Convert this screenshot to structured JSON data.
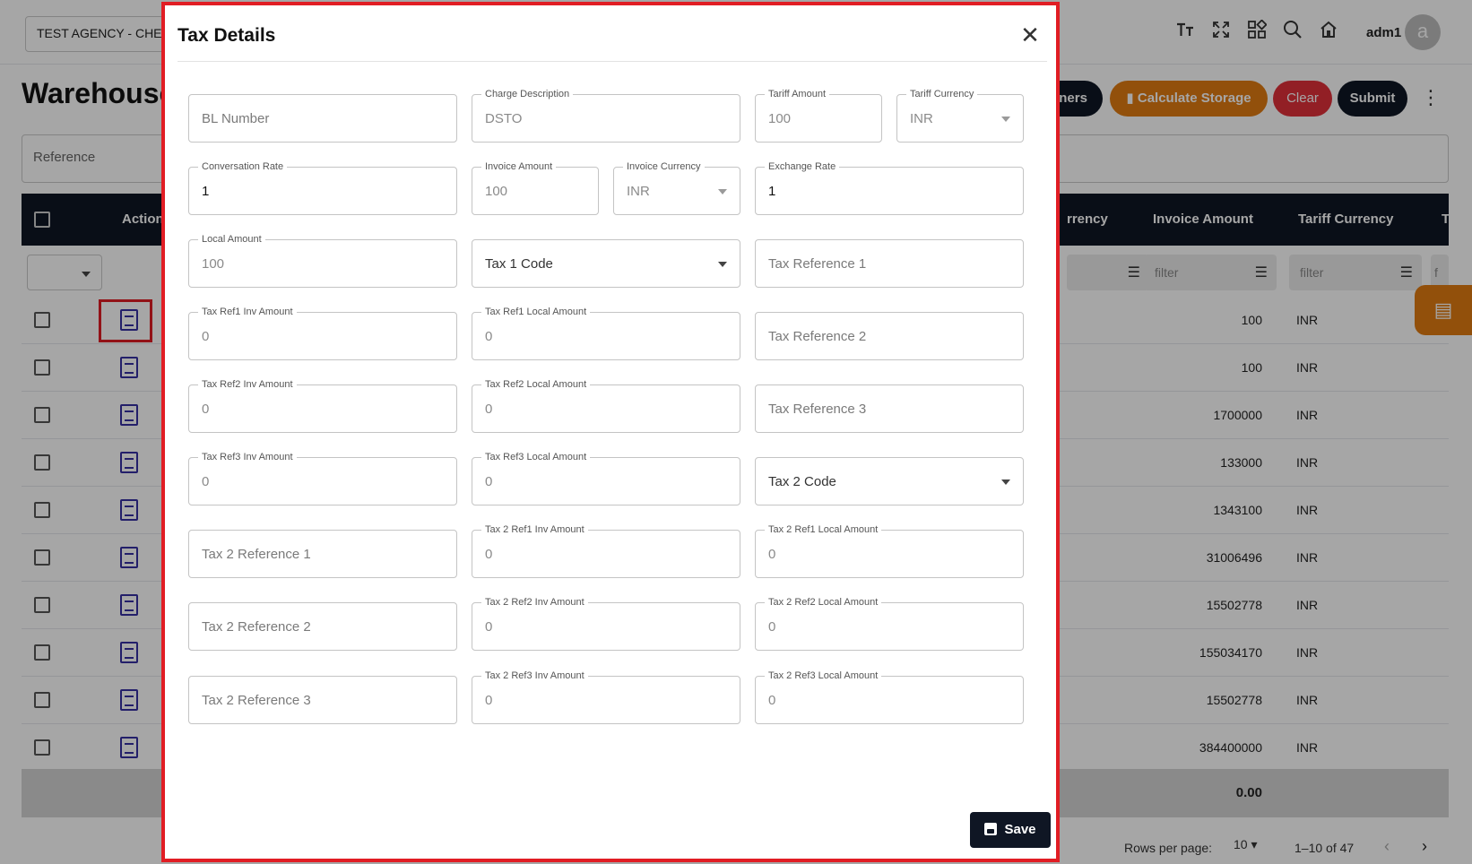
{
  "app": {
    "agency": "TEST AGENCY - CHENNAI",
    "user": "adm1",
    "avatar_letter": "a",
    "page_title": "Warehouse",
    "actions": {
      "containers_label": "iners",
      "calculate_label": "Calculate Storage",
      "clear_label": "Clear",
      "submit_label": "Submit"
    },
    "reference_placeholder": "Reference",
    "columns": {
      "action": "Action",
      "currency": "rrency",
      "invoice_amount": "Invoice Amount",
      "tariff_currency": "Tariff Currency",
      "next": "T"
    },
    "filter_placeholder": "filter",
    "filter_partial": "f",
    "rows": [
      {
        "invoice_amount": "100",
        "currency": "INR"
      },
      {
        "invoice_amount": "100",
        "currency": "INR"
      },
      {
        "invoice_amount": "1700000",
        "currency": "INR"
      },
      {
        "invoice_amount": "133000",
        "currency": "INR"
      },
      {
        "invoice_amount": "1343100",
        "currency": "INR"
      },
      {
        "invoice_amount": "31006496",
        "currency": "INR"
      },
      {
        "invoice_amount": "15502778",
        "currency": "INR"
      },
      {
        "invoice_amount": "155034170",
        "currency": "INR"
      },
      {
        "invoice_amount": "15502778",
        "currency": "INR"
      },
      {
        "invoice_amount": "384400000",
        "currency": "INR"
      }
    ],
    "total": "0.00",
    "footer": {
      "rows_per_page_label": "Rows per page:",
      "rows_per_page_value": "10",
      "range": "1–10 of 47"
    }
  },
  "modal": {
    "title": "Tax Details",
    "save_label": "Save",
    "fields": {
      "bl_number": {
        "placeholder": "BL Number"
      },
      "charge_description": {
        "label": "Charge Description",
        "value": "DSTO"
      },
      "tariff_amount": {
        "label": "Tariff Amount",
        "value": "100"
      },
      "tariff_currency": {
        "label": "Tariff Currency",
        "value": "INR"
      },
      "conversation_rate": {
        "label": "Conversation Rate",
        "value": "1"
      },
      "invoice_amount": {
        "label": "Invoice Amount",
        "value": "100"
      },
      "invoice_currency": {
        "label": "Invoice Currency",
        "value": "INR"
      },
      "exchange_rate": {
        "label": "Exchange Rate",
        "value": "1"
      },
      "local_amount": {
        "label": "Local Amount",
        "value": "100"
      },
      "tax1_code": {
        "placeholder": "Tax 1 Code"
      },
      "tax_reference_1": {
        "placeholder": "Tax Reference 1"
      },
      "tax_ref1_inv_amount": {
        "label": "Tax Ref1 Inv Amount",
        "value": "0"
      },
      "tax_ref1_local_amount": {
        "label": "Tax Ref1 Local Amount",
        "value": "0"
      },
      "tax_reference_2": {
        "placeholder": "Tax Reference 2"
      },
      "tax_ref2_inv_amount": {
        "label": "Tax Ref2 Inv Amount",
        "value": "0"
      },
      "tax_ref2_local_amount": {
        "label": "Tax Ref2 Local Amount",
        "value": "0"
      },
      "tax_reference_3": {
        "placeholder": "Tax Reference 3"
      },
      "tax_ref3_inv_amount": {
        "label": "Tax Ref3 Inv Amount",
        "value": "0"
      },
      "tax_ref3_local_amount": {
        "label": "Tax Ref3 Local Amount",
        "value": "0"
      },
      "tax2_code": {
        "placeholder": "Tax 2 Code"
      },
      "tax2_reference_1": {
        "placeholder": "Tax 2 Reference 1"
      },
      "tax2_ref1_inv_amount": {
        "label": "Tax 2 Ref1 Inv Amount",
        "value": "0"
      },
      "tax2_ref1_local_amount": {
        "label": "Tax 2 Ref1 Local Amount",
        "value": "0"
      },
      "tax2_reference_2": {
        "placeholder": "Tax 2 Reference 2"
      },
      "tax2_ref2_inv_amount": {
        "label": "Tax 2 Ref2 Inv Amount",
        "value": "0"
      },
      "tax2_ref2_local_amount": {
        "label": "Tax 2 Ref2 Local Amount",
        "value": "0"
      },
      "tax2_reference_3": {
        "placeholder": "Tax 2 Reference 3"
      },
      "tax2_ref3_inv_amount": {
        "label": "Tax 2 Ref3 Inv Amount",
        "value": "0"
      },
      "tax2_ref3_local_amount": {
        "label": "Tax 2 Ref3 Local Amount",
        "value": "0"
      }
    }
  },
  "colors": {
    "accent_dark": "#0f1624",
    "calculate_orange": "#e07b12",
    "clear_red": "#e0303a",
    "highlight_red": "#e11d24",
    "row_icon_indigo": "#3730a3"
  }
}
